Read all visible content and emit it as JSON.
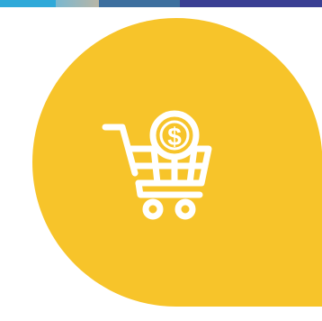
{
  "colors": {
    "badge_fill": "#f7c42a",
    "icon_stroke": "#ffffff",
    "top_strip": [
      "#2fa9d9",
      "#b9b6a6",
      "#3d6f9e",
      "#3a3f93"
    ]
  },
  "badge": {
    "icon": "shopping-cart-dollar-icon",
    "symbol": "$"
  }
}
